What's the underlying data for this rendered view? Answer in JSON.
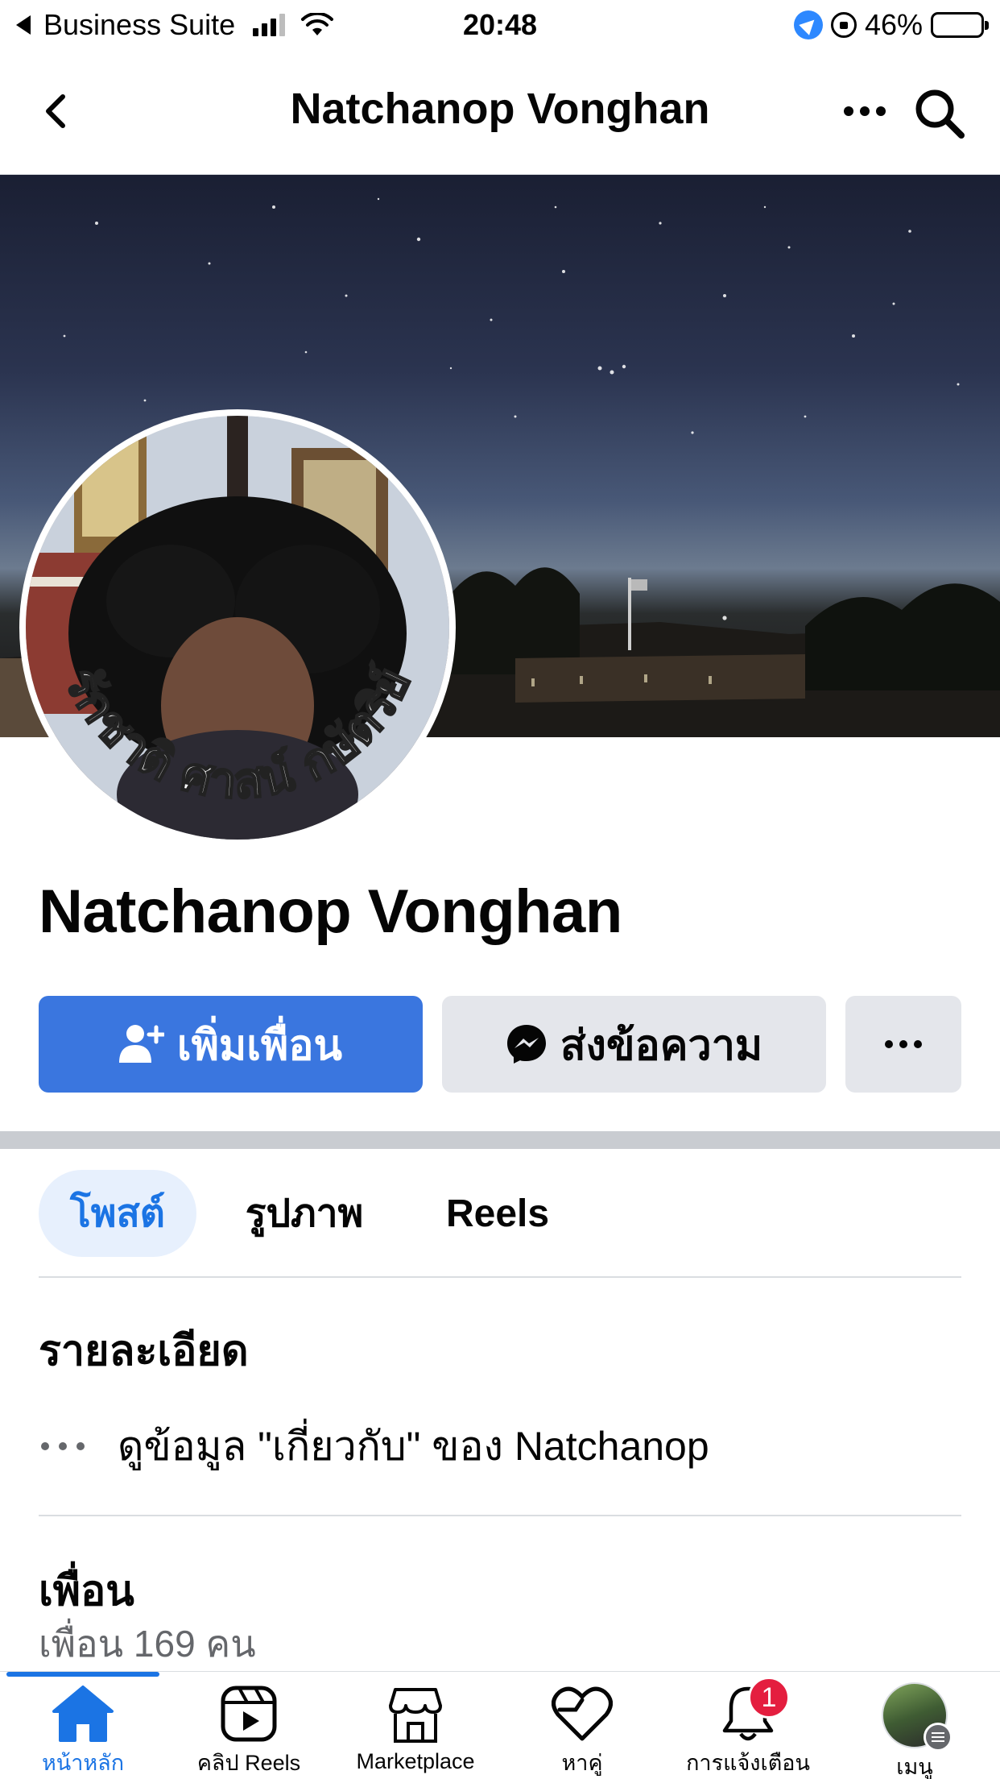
{
  "status_bar": {
    "back_app": "Business Suite",
    "time": "20:48",
    "battery": "46%",
    "battery_level": 0.46
  },
  "header": {
    "title": "Natchanop Vonghan"
  },
  "profile": {
    "name": "Natchanop Vonghan",
    "avatar_caption": "รักชาติ ศาสน์ กษัตริย์"
  },
  "actions": {
    "add_friend": "เพิ่มเพื่อน",
    "message": "ส่งข้อความ"
  },
  "tabs": [
    {
      "label": "โพสต์",
      "active": true
    },
    {
      "label": "รูปภาพ",
      "active": false
    },
    {
      "label": "Reels",
      "active": false
    }
  ],
  "details": {
    "title": "รายละเอียด",
    "about_link": "ดูข้อมูล \"เกี่ยวกับ\" ของ Natchanop"
  },
  "friends": {
    "title": "เพื่อน",
    "count_text": "เพื่อน 169 คน"
  },
  "bottom_nav": [
    {
      "label": "หน้าหลัก",
      "icon": "home-icon",
      "active": true
    },
    {
      "label": "คลิป Reels",
      "icon": "reels-icon",
      "active": false
    },
    {
      "label": "Marketplace",
      "icon": "marketplace-icon",
      "active": false
    },
    {
      "label": "หาคู่",
      "icon": "dating-heart-icon",
      "active": false
    },
    {
      "label": "การแจ้งเตือน",
      "icon": "bell-icon",
      "active": false,
      "badge": "1"
    },
    {
      "label": "เมนู",
      "icon": "menu-avatar",
      "active": false
    }
  ],
  "colors": {
    "primary": "#3a76df",
    "tab_active_bg": "#e7f0fd",
    "tab_active_text": "#1b74e4",
    "badge": "#e41e3f"
  }
}
